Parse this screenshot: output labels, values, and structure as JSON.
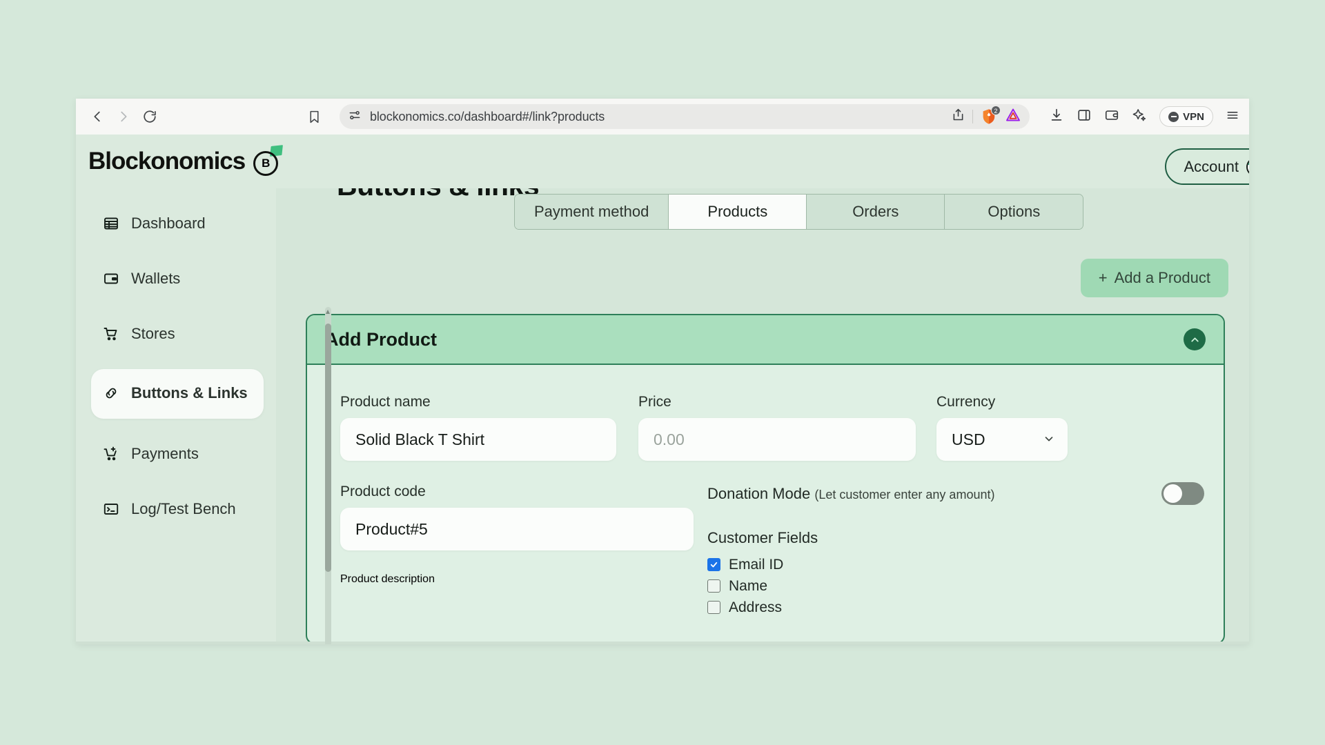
{
  "browser": {
    "back_icon": "chevron-left-icon",
    "forward_icon": "chevron-right-icon",
    "reload_icon": "reload-icon",
    "bookmark_icon": "bookmark-icon",
    "site_settings_icon": "tune-icon",
    "url": "blockonomics.co/dashboard#/link?products",
    "share_icon": "share-icon",
    "shield_icon": "brave-shield-icon",
    "shield_badge": "2",
    "rewards_icon": "bat-triangle-icon",
    "downloads_icon": "download-icon",
    "sidebar_icon": "panel-icon",
    "wallet_icon": "wallet-icon",
    "leo_icon": "sparkle-icon",
    "vpn_label": "VPN",
    "menu_icon": "hamburger-menu-icon"
  },
  "brand": {
    "name": "Blockonomics",
    "mark_letter": "B"
  },
  "account": {
    "label": "Account",
    "avatar": "user-avatar"
  },
  "sidebar": {
    "items": [
      {
        "label": "Dashboard",
        "icon": "dashboard-icon",
        "active": false
      },
      {
        "label": "Wallets",
        "icon": "wallet-icon",
        "active": false
      },
      {
        "label": "Stores",
        "icon": "cart-icon",
        "active": false
      },
      {
        "label": "Buttons & Links",
        "icon": "link-icon",
        "active": true
      },
      {
        "label": "Payments",
        "icon": "cart-plus-icon",
        "active": false
      },
      {
        "label": "Log/Test Bench",
        "icon": "terminal-icon",
        "active": false
      }
    ]
  },
  "main": {
    "heading": "Buttons & links",
    "tabs": [
      {
        "label": "Payment method",
        "active": false
      },
      {
        "label": "Products",
        "active": true
      },
      {
        "label": "Orders",
        "active": false
      },
      {
        "label": "Options",
        "active": false
      }
    ],
    "add_product_button": "Add a Product",
    "add_product_plus": "+"
  },
  "card": {
    "title": "Add Product",
    "collapse_icon": "chevron-up-icon",
    "fields": {
      "product_name_label": "Product name",
      "product_name_value": "Solid Black T Shirt",
      "price_label": "Price",
      "price_placeholder": "0.00",
      "currency_label": "Currency",
      "currency_value": "USD",
      "currency_chevron": "chevron-down-icon",
      "product_code_label": "Product code",
      "product_code_value": "Product#5",
      "product_description_label": "Product description"
    },
    "donation": {
      "label": "Donation Mode",
      "hint": "(Let customer enter any amount)",
      "enabled": false
    },
    "customer_fields": {
      "title": "Customer Fields",
      "options": [
        {
          "label": "Email ID",
          "checked": true
        },
        {
          "label": "Name",
          "checked": false
        },
        {
          "label": "Address",
          "checked": false
        }
      ]
    }
  },
  "colors": {
    "page_bg": "#d5e8da",
    "app_bg": "#dbeade",
    "card_border": "#2e7f59",
    "card_header": "#aadfbe",
    "accent_button": "#9fd9b4",
    "checkbox_checked": "#1b73e8"
  }
}
